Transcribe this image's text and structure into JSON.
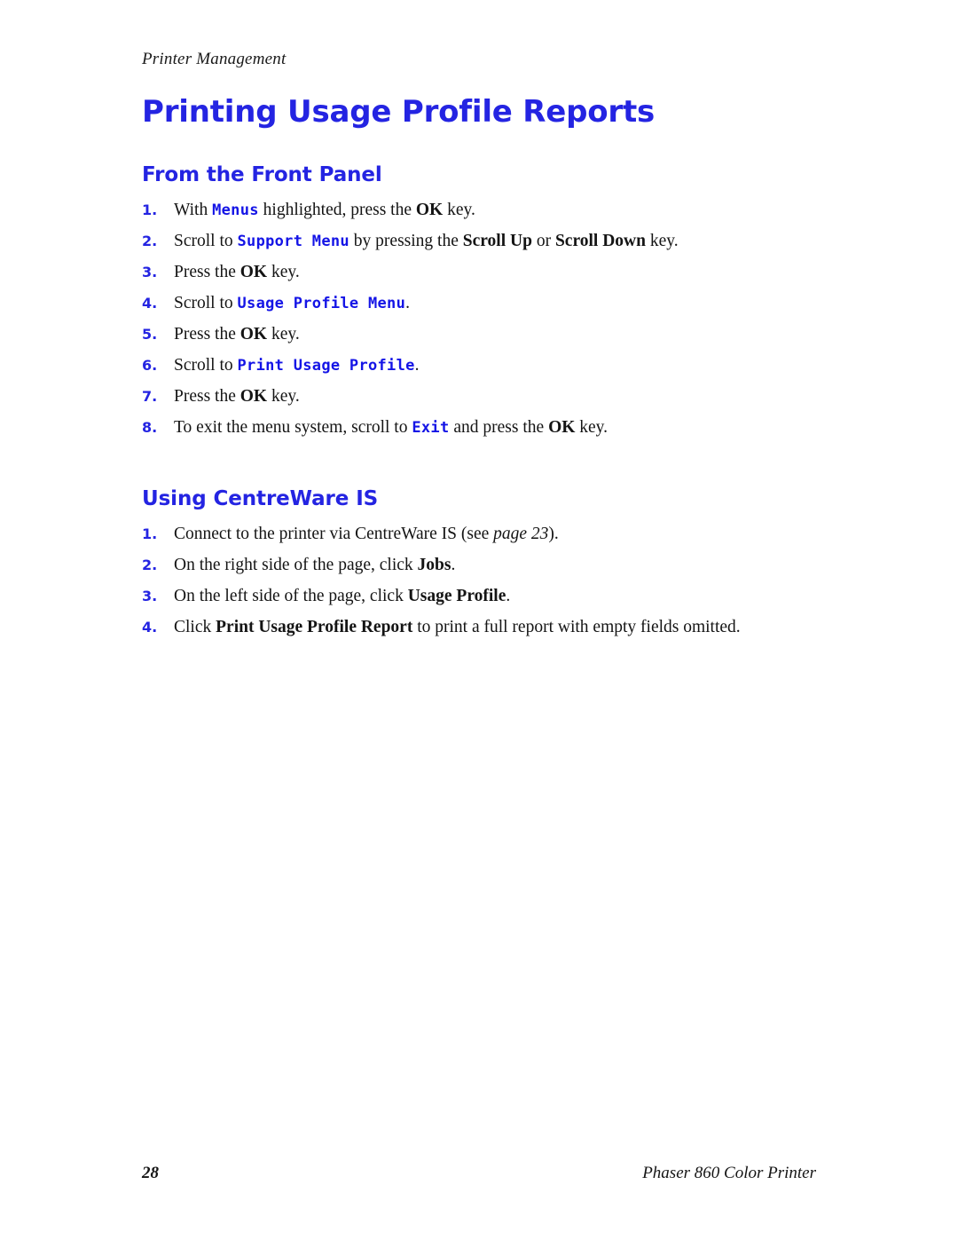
{
  "header": {
    "running_head": "Printer Management"
  },
  "title": "Printing Usage Profile Reports",
  "colors": {
    "heading_blue": "#2424e2",
    "mono_blue": "#1414e6",
    "body_text": "#141414"
  },
  "sections": [
    {
      "heading": "From the Front Panel",
      "steps": [
        {
          "num": "1.",
          "runs": [
            {
              "t": "With ",
              "s": "plain"
            },
            {
              "t": "Menus",
              "s": "mono"
            },
            {
              "t": " highlighted, press the ",
              "s": "plain"
            },
            {
              "t": "OK",
              "s": "bold"
            },
            {
              "t": " key.",
              "s": "plain"
            }
          ]
        },
        {
          "num": "2.",
          "runs": [
            {
              "t": "Scroll to ",
              "s": "plain"
            },
            {
              "t": "Support Menu",
              "s": "mono"
            },
            {
              "t": " by pressing the ",
              "s": "plain"
            },
            {
              "t": "Scroll Up",
              "s": "bold"
            },
            {
              "t": " or ",
              "s": "plain"
            },
            {
              "t": "Scroll Down",
              "s": "bold"
            },
            {
              "t": " key.",
              "s": "plain"
            }
          ]
        },
        {
          "num": "3.",
          "runs": [
            {
              "t": "Press the ",
              "s": "plain"
            },
            {
              "t": "OK",
              "s": "bold"
            },
            {
              "t": " key.",
              "s": "plain"
            }
          ]
        },
        {
          "num": "4.",
          "runs": [
            {
              "t": "Scroll to ",
              "s": "plain"
            },
            {
              "t": "Usage Profile Menu",
              "s": "mono"
            },
            {
              "t": ".",
              "s": "plain"
            }
          ]
        },
        {
          "num": "5.",
          "runs": [
            {
              "t": "Press the ",
              "s": "plain"
            },
            {
              "t": "OK",
              "s": "bold"
            },
            {
              "t": " key.",
              "s": "plain"
            }
          ]
        },
        {
          "num": "6.",
          "runs": [
            {
              "t": "Scroll to ",
              "s": "plain"
            },
            {
              "t": "Print Usage Profile",
              "s": "mono"
            },
            {
              "t": ".",
              "s": "plain"
            }
          ]
        },
        {
          "num": "7.",
          "runs": [
            {
              "t": "Press the ",
              "s": "plain"
            },
            {
              "t": "OK",
              "s": "bold"
            },
            {
              "t": " key.",
              "s": "plain"
            }
          ]
        },
        {
          "num": "8.",
          "runs": [
            {
              "t": "To exit the menu system, scroll to ",
              "s": "plain"
            },
            {
              "t": "Exit",
              "s": "mono"
            },
            {
              "t": " and press the ",
              "s": "plain"
            },
            {
              "t": "OK",
              "s": "bold"
            },
            {
              "t": " key.",
              "s": "plain"
            }
          ]
        }
      ]
    },
    {
      "heading": "Using CentreWare IS",
      "steps": [
        {
          "num": "1.",
          "runs": [
            {
              "t": "Connect to the printer via CentreWare IS (see ",
              "s": "plain"
            },
            {
              "t": "page 23",
              "s": "italic"
            },
            {
              "t": ").",
              "s": "plain"
            }
          ]
        },
        {
          "num": "2.",
          "runs": [
            {
              "t": "On the right side of the page, click ",
              "s": "plain"
            },
            {
              "t": "Jobs",
              "s": "bold"
            },
            {
              "t": ".",
              "s": "plain"
            }
          ]
        },
        {
          "num": "3.",
          "runs": [
            {
              "t": "On the left side of the page, click ",
              "s": "plain"
            },
            {
              "t": "Usage Profile",
              "s": "bold"
            },
            {
              "t": ".",
              "s": "plain"
            }
          ]
        },
        {
          "num": "4.",
          "runs": [
            {
              "t": "Click ",
              "s": "plain"
            },
            {
              "t": "Print Usage Profile Report",
              "s": "bold"
            },
            {
              "t": " to print a full report with empty fields omitted.",
              "s": "plain"
            }
          ]
        }
      ]
    }
  ],
  "footer": {
    "page_number": "28",
    "product": "Phaser 860 Color Printer"
  }
}
